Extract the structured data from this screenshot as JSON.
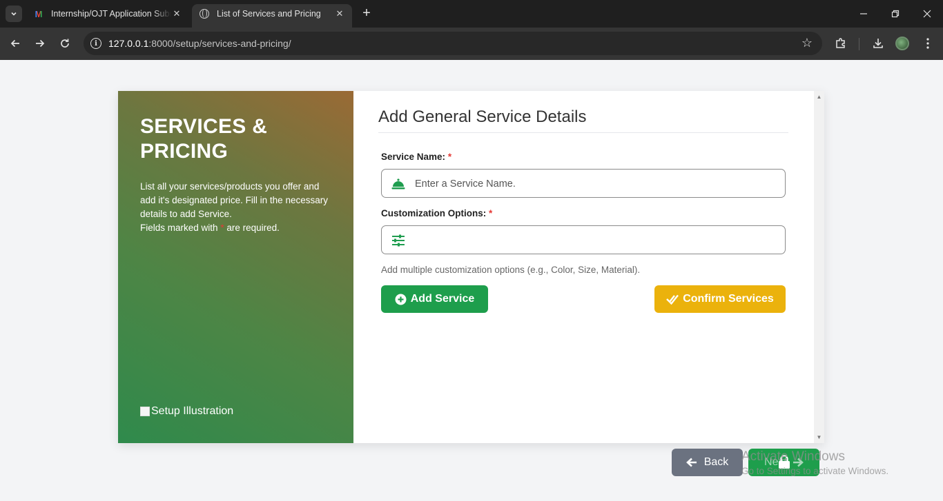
{
  "browser": {
    "tabs": [
      {
        "title": "Internship/OJT Application Subm",
        "icon": "gmail-icon"
      },
      {
        "title": "List of Services and Pricing",
        "icon": "globe-icon"
      }
    ],
    "new_tab": "+",
    "url_host": "127.0.0.1",
    "url_path": ":8000/setup/services-and-pricing/"
  },
  "hero": {
    "title": "SERVICES & PRICING",
    "description": "List all your services/products you offer and add it's designated price. Fill in the necessary details to add Service.",
    "required_note_prefix": "Fields marked with",
    "required_note_suffix": "are required.",
    "asterisk": "*",
    "image_alt": "Setup Illustration"
  },
  "form": {
    "title": "Add General Service Details",
    "service_name_label": "Service Name:",
    "service_name_placeholder": "Enter a Service Name.",
    "customization_label": "Customization Options:",
    "customization_value": "",
    "help_text": "Add multiple customization options (e.g., Color, Size, Material).",
    "add_button": "Add Service",
    "confirm_button": "Confirm Services"
  },
  "footer": {
    "back_button": "Back",
    "next_button": "Next"
  },
  "watermark": {
    "title": "Activate Windows",
    "subtitle": "Go to Settings to activate Windows."
  },
  "colors": {
    "primary_green": "#1e9e4c",
    "confirm_yellow": "#ebb20c",
    "back_gray": "#6b7280",
    "required_red": "#e53935"
  }
}
